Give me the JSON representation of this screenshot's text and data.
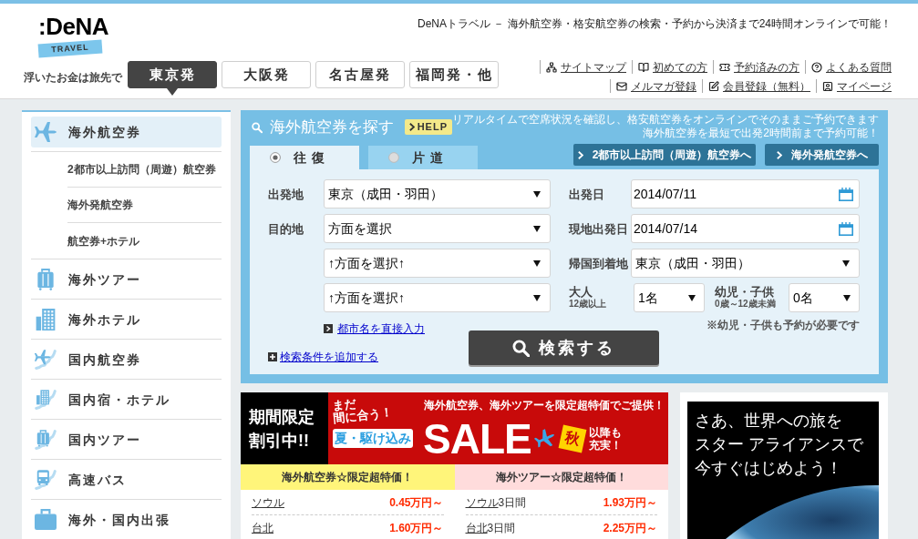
{
  "header": {
    "logo": {
      "wordmark": ":DeNA",
      "band": "TRAVEL"
    },
    "tagline": "浮いたお金は旅先で",
    "intro": "DeNAトラベル － 海外航空券・格安航空券の検索・予約から決済まで24時間オンラインで可能！"
  },
  "departure_tabs": [
    {
      "label": "東京発",
      "selected": true
    },
    {
      "label": "大阪発",
      "selected": false
    },
    {
      "label": "名古屋発",
      "selected": false
    },
    {
      "label": "福岡発・他",
      "selected": false
    }
  ],
  "header_links": [
    [
      "サイトマップ",
      "初めての方",
      "予約済みの方",
      "よくある質問"
    ],
    [
      "メルマガ登録",
      "会員登録（無料）",
      "マイページ"
    ]
  ],
  "sidebar": {
    "items": [
      {
        "label": "海外航空券",
        "selected": true,
        "children": [
          {
            "label": "2都市以上訪問（周遊）航空券"
          },
          {
            "label": "海外発航空券"
          },
          {
            "label": "航空券+ホテル"
          }
        ]
      },
      {
        "label": "海外ツアー",
        "selected": false
      },
      {
        "label": "海外ホテル",
        "selected": false
      },
      {
        "label": "国内航空券",
        "selected": false
      },
      {
        "label": "国内宿・ホテル",
        "selected": false
      },
      {
        "label": "国内ツアー",
        "selected": false
      },
      {
        "label": "高速バス",
        "selected": false
      },
      {
        "label": "海外・国内出張",
        "selected": false
      }
    ]
  },
  "search": {
    "title": "海外航空券を探す",
    "help": "HELP",
    "info": [
      "リアルタイムで空席状況を確認し、格安航空券をオンラインでそのままご予約できます",
      "海外航空券を最短で出発2時間前まで予約可能！"
    ],
    "trip_tabs": [
      {
        "label": "往復",
        "selected": true
      },
      {
        "label": "片道",
        "selected": false
      }
    ],
    "shortcut_buttons": [
      "2都市以上訪問（周遊）航空券へ",
      "海外発航空券へ"
    ],
    "left_fields": [
      {
        "label": "出発地",
        "kind": "select",
        "value": "東京（成田・羽田）"
      },
      {
        "label": "目的地",
        "kind": "select",
        "value": "方面を選択"
      },
      {
        "kind": "select",
        "value": "↑方面を選択↑"
      },
      {
        "kind": "select",
        "value": "↑方面を選択↑"
      }
    ],
    "right_fields": [
      {
        "label": "出発日",
        "kind": "date",
        "value": "2014/07/11"
      },
      {
        "label": "現地出発日",
        "kind": "date",
        "value": "2014/07/14"
      },
      {
        "label": "帰国到着地",
        "kind": "select",
        "value": "東京（成田・羽田）"
      }
    ],
    "passengers": [
      {
        "label": "大人",
        "sublabel": "12歳以上",
        "value": "1名"
      },
      {
        "label": "幼児・子供",
        "sublabel": "0歳～12歳未満",
        "value": "0名"
      }
    ],
    "note": "※幼児・子供も予約が必要です",
    "city_link": "都市名を直接入力",
    "add_conditions_link": "検索条件を追加する",
    "submit": "検索する"
  },
  "promo": {
    "badge": [
      "期間限定",
      "割引中!!"
    ],
    "banner": {
      "catch": [
        "まだ",
        "間に合う！"
      ],
      "subtitle": "夏・駆け込み",
      "headline": "海外航空券、海外ツアーを限定超特価でご提供！",
      "title": "SALE",
      "star": "秋",
      "tail": "以降も充実！"
    },
    "columns": [
      {
        "heading": "海外航空券☆限定超特価！",
        "color": "#fff57a",
        "rows": [
          {
            "destination": "ソウル",
            "price": "0.45万円～"
          },
          {
            "destination": "台北",
            "price": "1.60万円～"
          }
        ]
      },
      {
        "heading": "海外ツアー☆限定超特価！",
        "color": "#ffdcdc",
        "rows": [
          {
            "destination": "ソウル",
            "suffix": "3日間",
            "price": "1.93万円～"
          },
          {
            "destination": "台北",
            "suffix": "3日間",
            "price": "2.25万円～"
          }
        ]
      }
    ]
  },
  "ad": {
    "message": [
      "さあ、世界への旅を",
      "スター アライアンスで",
      "今すぐはじめよう！"
    ]
  }
}
